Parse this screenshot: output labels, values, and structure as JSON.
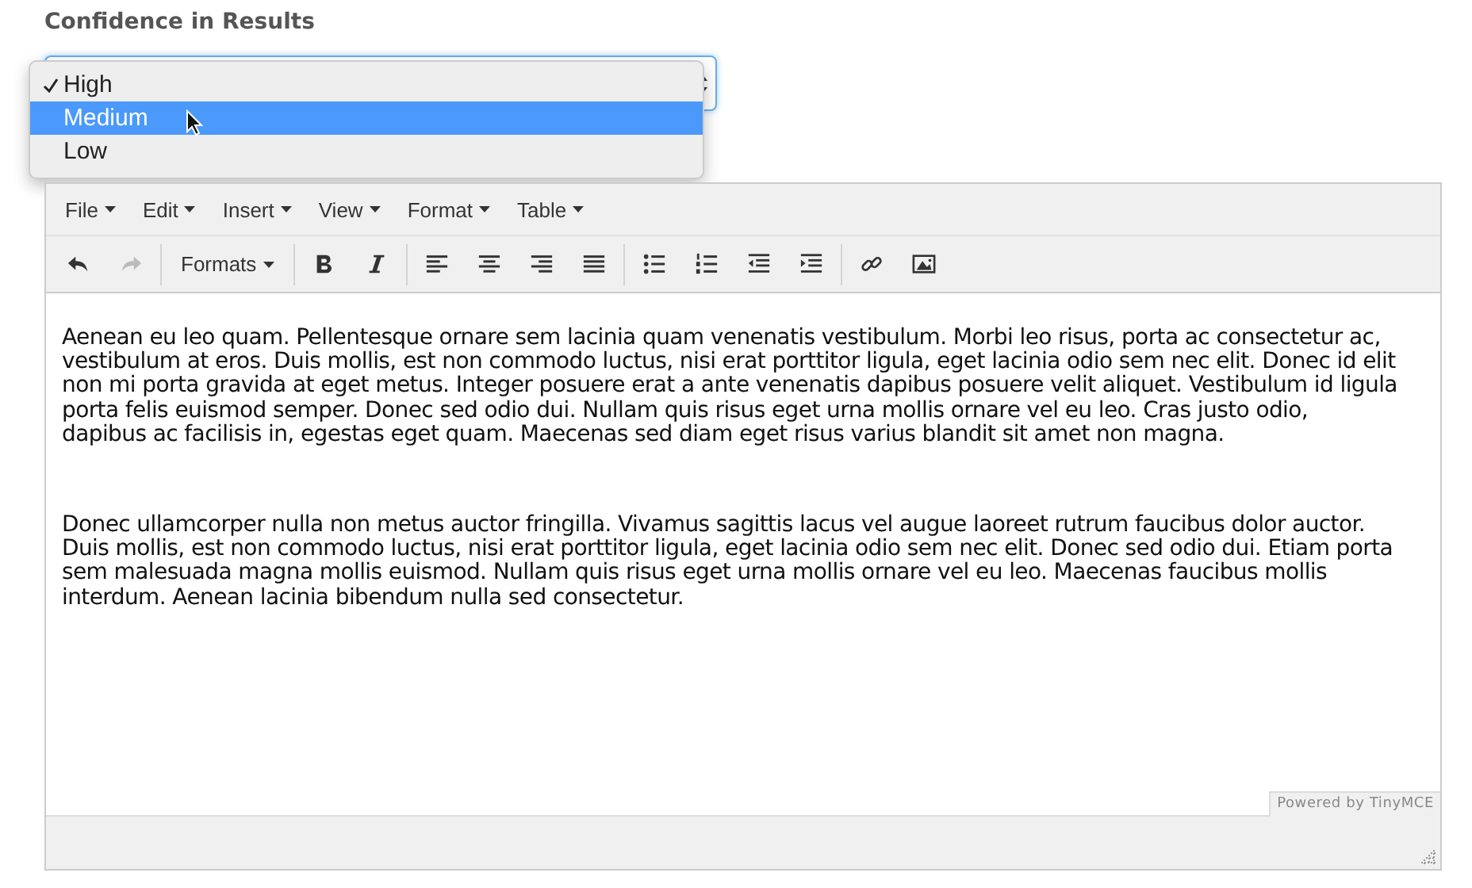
{
  "field": {
    "label": "Confidence in Results",
    "options": [
      {
        "label": "High",
        "checked": true,
        "selected": false
      },
      {
        "label": "Medium",
        "checked": false,
        "selected": true
      },
      {
        "label": "Low",
        "checked": false,
        "selected": false
      }
    ]
  },
  "editor": {
    "menubar": [
      {
        "label": "File"
      },
      {
        "label": "Edit"
      },
      {
        "label": "Insert"
      },
      {
        "label": "View"
      },
      {
        "label": "Format"
      },
      {
        "label": "Table"
      }
    ],
    "toolbar": [
      [
        {
          "kind": "undo",
          "disabled": false
        },
        {
          "kind": "redo",
          "disabled": true
        }
      ],
      [
        {
          "kind": "menu",
          "label": "Formats"
        }
      ],
      [
        {
          "kind": "bold"
        },
        {
          "kind": "italic"
        }
      ],
      [
        {
          "kind": "align-left"
        },
        {
          "kind": "align-center"
        },
        {
          "kind": "align-right"
        },
        {
          "kind": "justify"
        }
      ],
      [
        {
          "kind": "bullets"
        },
        {
          "kind": "numbers"
        },
        {
          "kind": "outdent"
        },
        {
          "kind": "indent"
        }
      ],
      [
        {
          "kind": "link"
        },
        {
          "kind": "image"
        }
      ]
    ],
    "paragraphs": [
      "Aenean eu leo quam. Pellentesque ornare sem lacinia quam venenatis vestibulum. Morbi leo risus, porta ac consectetur ac, vestibulum at eros. Duis mollis, est non commodo luctus, nisi erat porttitor ligula, eget lacinia odio sem nec elit. Donec id elit non mi porta gravida at eget metus. Integer posuere erat a ante venenatis dapibus posuere velit aliquet. Vestibulum id ligula porta felis euismod semper. Donec sed odio dui. Nullam quis risus eget urna mollis ornare vel eu leo. Cras justo odio, dapibus ac facilisis in, egestas eget quam. Maecenas sed diam eget risus varius blandit sit amet non magna.",
      "Donec ullamcorper nulla non metus auctor fringilla. Vivamus sagittis lacus vel augue laoreet rutrum faucibus dolor auctor. Duis mollis, est non commodo luctus, nisi erat porttitor ligula, eget lacinia odio sem nec elit. Donec sed odio dui. Etiam porta sem malesuada magna mollis euismod. Nullam quis risus eget urna mollis ornare vel eu leo. Maecenas faucibus mollis interdum. Aenean lacinia bibendum nulla sed consectetur."
    ],
    "branding": "Powered by TinyMCE"
  }
}
